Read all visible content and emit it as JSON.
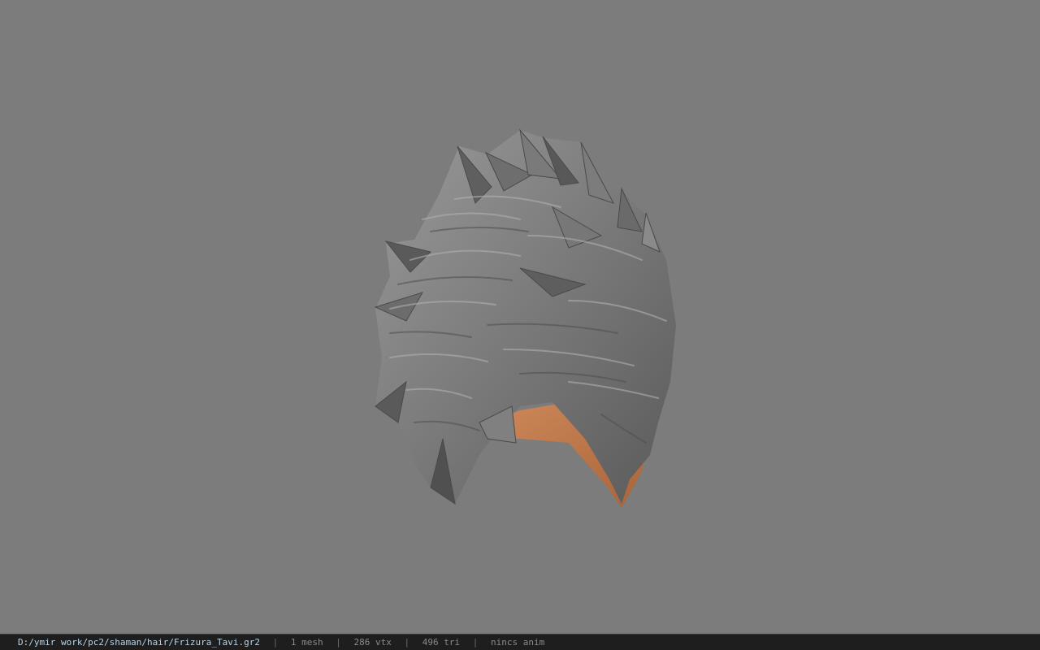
{
  "viewer": {
    "background_color": "#7c7c7c",
    "model": {
      "description_icon": "hair-mesh",
      "hair_color": "#8a8a8a",
      "skin_color": "#c07a4e"
    }
  },
  "status_bar": {
    "file_path": "D:/ymir work/pc2/shaman/hair/Frizura_Tavi.gr2",
    "separator": "|",
    "mesh_count": "1 mesh",
    "vertex_count": "286 vtx",
    "triangle_count": "496 tri",
    "animation": "nincs anim"
  }
}
